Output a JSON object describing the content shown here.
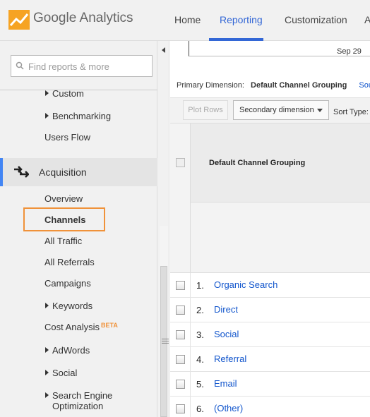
{
  "header": {
    "brand_google": "Google",
    "brand_product": "Analytics",
    "nav": [
      {
        "label": "Home"
      },
      {
        "label": "Reporting"
      },
      {
        "label": "Customization"
      },
      {
        "label": "A"
      }
    ],
    "active_nav": "Reporting"
  },
  "sidebar": {
    "search_placeholder": "Find reports & more",
    "items": [
      {
        "label": "Custom"
      },
      {
        "label": "Benchmarking"
      },
      {
        "label": "Users Flow"
      },
      {
        "label": "Acquisition"
      },
      {
        "label": "Overview"
      },
      {
        "label": "Channels"
      },
      {
        "label": "All Traffic"
      },
      {
        "label": "All Referrals"
      },
      {
        "label": "Campaigns"
      },
      {
        "label": "Keywords"
      },
      {
        "label": "Cost Analysis"
      },
      {
        "label": "AdWords"
      },
      {
        "label": "Social"
      },
      {
        "label": "Search Engine"
      },
      {
        "label": "Optimization"
      }
    ],
    "beta_badge": "BETA",
    "highlight_color": "#f0923a",
    "active_section_color": "#4285f4"
  },
  "main": {
    "timeline_date": "Sep 29",
    "primary_dimension_label": "Primary Dimension:",
    "primary_dimension_value": "Default Channel Grouping",
    "primary_dimension_link": "Sou",
    "toolbar": {
      "plot_rows": "Plot Rows",
      "secondary_dimension": "Secondary dimension",
      "sort_type": "Sort Type:"
    },
    "table": {
      "header": "Default Channel Grouping",
      "rows": [
        {
          "index": "1.",
          "label": "Organic Search"
        },
        {
          "index": "2.",
          "label": "Direct"
        },
        {
          "index": "3.",
          "label": "Social"
        },
        {
          "index": "4.",
          "label": "Referral"
        },
        {
          "index": "5.",
          "label": "Email"
        },
        {
          "index": "6.",
          "label": "(Other)"
        }
      ]
    }
  }
}
